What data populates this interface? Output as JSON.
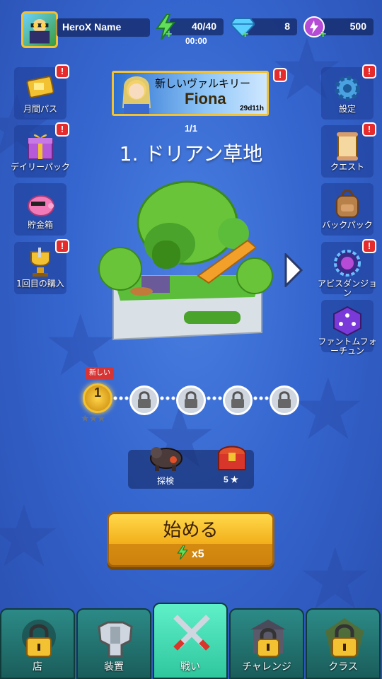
{
  "player": {
    "name": "HeroX Name"
  },
  "resources": {
    "energy": {
      "value": "40/40",
      "timer": "00:00",
      "icon": "lightning-icon"
    },
    "gems": {
      "value": "8",
      "icon": "diamond-icon"
    },
    "orbs": {
      "value": "500",
      "icon": "purple-orb-icon"
    }
  },
  "left_menu": [
    {
      "label": "月間パス",
      "badge": "!"
    },
    {
      "label": "デイリーパック",
      "badge": "!"
    },
    {
      "label": "貯金箱",
      "badge": ""
    },
    {
      "label": "1回目の購入",
      "badge": "!"
    }
  ],
  "right_menu": [
    {
      "label": "設定",
      "badge": "!"
    },
    {
      "label": "クエスト",
      "badge": "!"
    },
    {
      "label": "バックパック",
      "badge": ""
    },
    {
      "label": "アビスダンジョン",
      "badge": "!"
    },
    {
      "label": "ファントムフォーチュン",
      "badge": ""
    }
  ],
  "banner": {
    "title": "新しいヴァルキリー",
    "hero_name": "Fiona",
    "time_left": "29d11h",
    "badge": "!"
  },
  "stage": {
    "progress": "1/1",
    "title": "1. ドリアン草地"
  },
  "level_path": {
    "new_tag": "新しい",
    "current_level": "1",
    "stars": "★★★",
    "locked_count": 4
  },
  "reward": {
    "label": "探検",
    "count": "5 ★"
  },
  "start_button": {
    "label": "始める",
    "cost": "x5"
  },
  "bottom_nav": [
    {
      "label": "店"
    },
    {
      "label": "装置"
    },
    {
      "label": "戦い"
    },
    {
      "label": "チャレンジ"
    },
    {
      "label": "クラス"
    }
  ],
  "colors": {
    "gold": "#f2c232",
    "badge_red": "#e52b2b",
    "active_tab": "#2fc69e"
  }
}
